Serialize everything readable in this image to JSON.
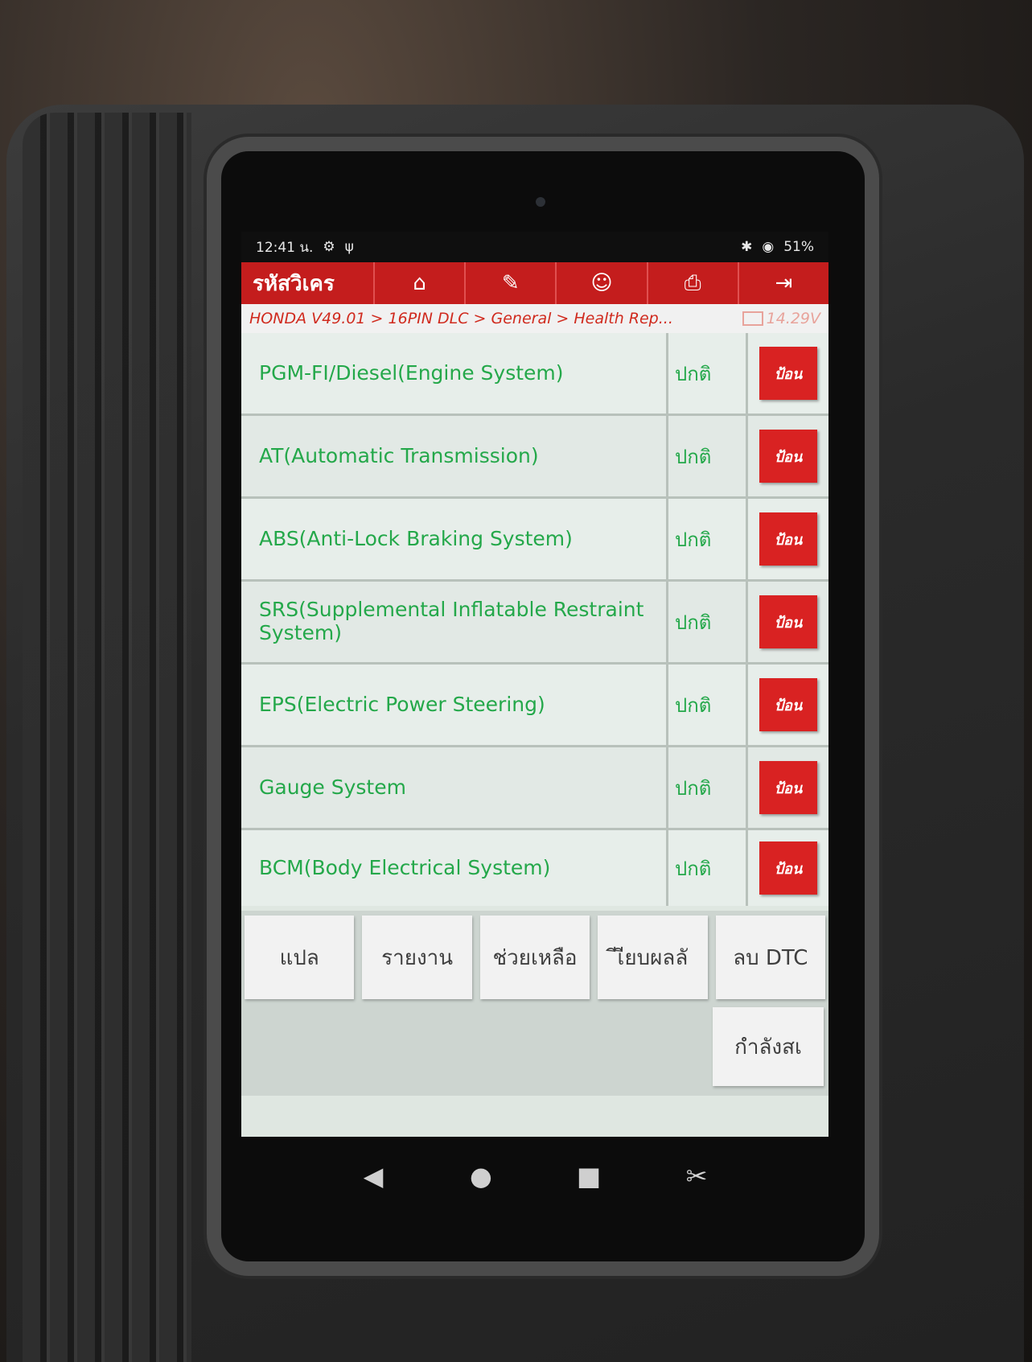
{
  "status_bar": {
    "time": "12:41 น.",
    "battery": "51%"
  },
  "toolbar": {
    "title": "รหัสวิเคร",
    "icons": [
      "home-icon",
      "edit-report-icon",
      "user-icon",
      "print-icon",
      "exit-icon"
    ]
  },
  "breadcrumb": {
    "path": "HONDA V49.01 > 16PIN DLC > General > Health Rep...",
    "voltage": "14.29V"
  },
  "systems": [
    {
      "name": "PGM-FI/Diesel(Engine System)",
      "status": "ปกติ",
      "button": "ป้อน"
    },
    {
      "name": "AT(Automatic Transmission)",
      "status": "ปกติ",
      "button": "ป้อน"
    },
    {
      "name": "ABS(Anti-Lock Braking System)",
      "status": "ปกติ",
      "button": "ป้อน"
    },
    {
      "name": "SRS(Supplemental Inflatable Restraint System)",
      "status": "ปกติ",
      "button": "ป้อน"
    },
    {
      "name": "EPS(Electric Power Steering)",
      "status": "ปกติ",
      "button": "ป้อน"
    },
    {
      "name": "Gauge System",
      "status": "ปกติ",
      "button": "ป้อน"
    },
    {
      "name": "BCM(Body Electrical System)",
      "status": "ปกติ",
      "button": "ป้อน"
    }
  ],
  "actions": {
    "translate": "แปล",
    "report": "รายงาน",
    "help": "ช่วยเหลือ",
    "compare": "ีเียบผลลั",
    "clear_dtc": "ลบ DTC",
    "saving": "กำลังสเ"
  },
  "colors": {
    "toolbar_red": "#c41d1d",
    "ok_green": "#24a84a",
    "enter_red": "#d92222"
  }
}
